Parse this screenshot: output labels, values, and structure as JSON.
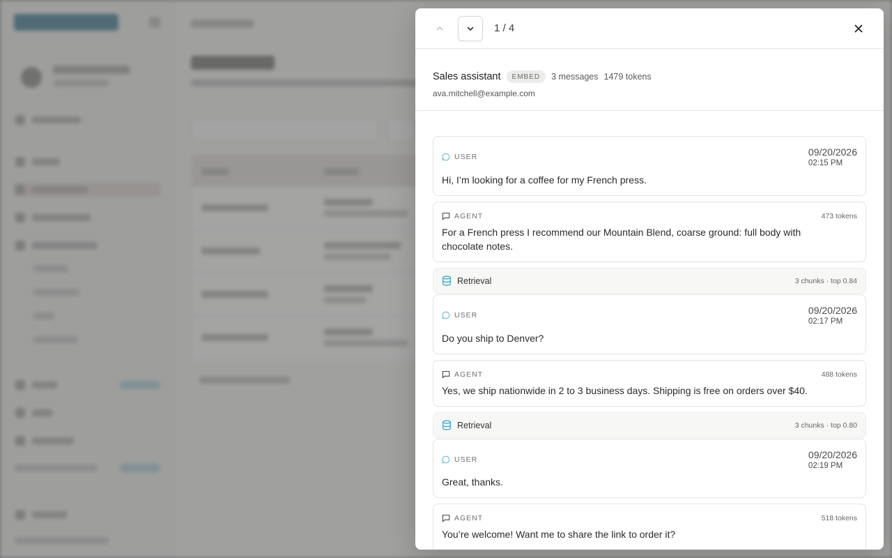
{
  "nav": {
    "pager": "1 / 4"
  },
  "conversation": {
    "agent_name": "Sales assistant",
    "channel_badge": "EMBED",
    "messages_count": "3 messages",
    "tokens_total": "1479 tokens",
    "user_email": "ava.mitchell@example.com"
  },
  "messages": [
    {
      "role": "USER",
      "date": "09/20/2026",
      "time": "02:15 PM",
      "text": "Hi, I’m looking for a coffee for my French press."
    },
    {
      "role": "AGENT",
      "tokens": "473 tokens",
      "text": "For a French press I recommend our Mountain Blend, coarse ground: full body with chocolate notes."
    },
    {
      "label": "Retrieval",
      "meta": "3 chunks · top 0.84"
    },
    {
      "role": "USER",
      "date": "09/20/2026",
      "time": "02:17 PM",
      "text": "Do you ship to Denver?"
    },
    {
      "role": "AGENT",
      "tokens": "488 tokens",
      "text": "Yes, we ship nationwide in 2 to 3 business days. Shipping is free on orders over $40."
    },
    {
      "label": "Retrieval",
      "meta": "3 chunks · top 0.80"
    },
    {
      "role": "USER",
      "date": "09/20/2026",
      "time": "02:19 PM",
      "text": "Great, thanks."
    },
    {
      "role": "AGENT",
      "tokens": "518 tokens",
      "text": "You’re welcome! Want me to share the link to order it?"
    }
  ],
  "colors": {
    "overlay": "#464646",
    "retrieval_icon": "#2aa7c4",
    "user_icon": "#6ab8d8",
    "border": "#e3e3e3"
  },
  "icons": {
    "prev": "chevron-up-icon",
    "next": "chevron-down-icon",
    "close": "close-icon",
    "user": "chat-bubble-round-icon",
    "agent": "chat-bubble-square-icon",
    "retrieval": "database-icon"
  }
}
